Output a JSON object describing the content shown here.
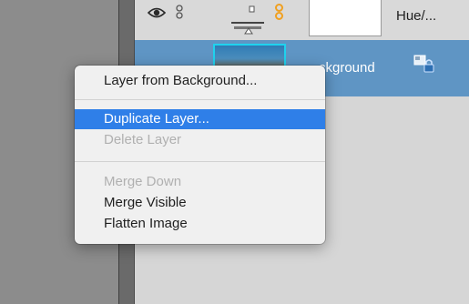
{
  "layers": {
    "top_layer": {
      "name": "Hue/..."
    },
    "background_layer": {
      "name": "ckground"
    }
  },
  "context_menu": {
    "items": [
      {
        "label": "Layer from Background...",
        "state": "enabled"
      },
      {
        "label": "Duplicate Layer...",
        "state": "selected"
      },
      {
        "label": "Delete Layer",
        "state": "disabled"
      },
      {
        "label": "Merge Down",
        "state": "disabled"
      },
      {
        "label": "Merge Visible",
        "state": "enabled"
      },
      {
        "label": "Flatten Image",
        "state": "enabled"
      }
    ]
  },
  "icons": {
    "visibility": "eye-icon",
    "link": "chain-icon",
    "adjustment": "levels-adjustment-icon",
    "mask_link": "link-icon",
    "lock": "lock-icon"
  },
  "colors": {
    "selection": "#2f7fe8",
    "layer_selected_row": "#5f95c4",
    "thumbnail_border": "#1fd2ee",
    "link_accent": "#f0a020"
  }
}
